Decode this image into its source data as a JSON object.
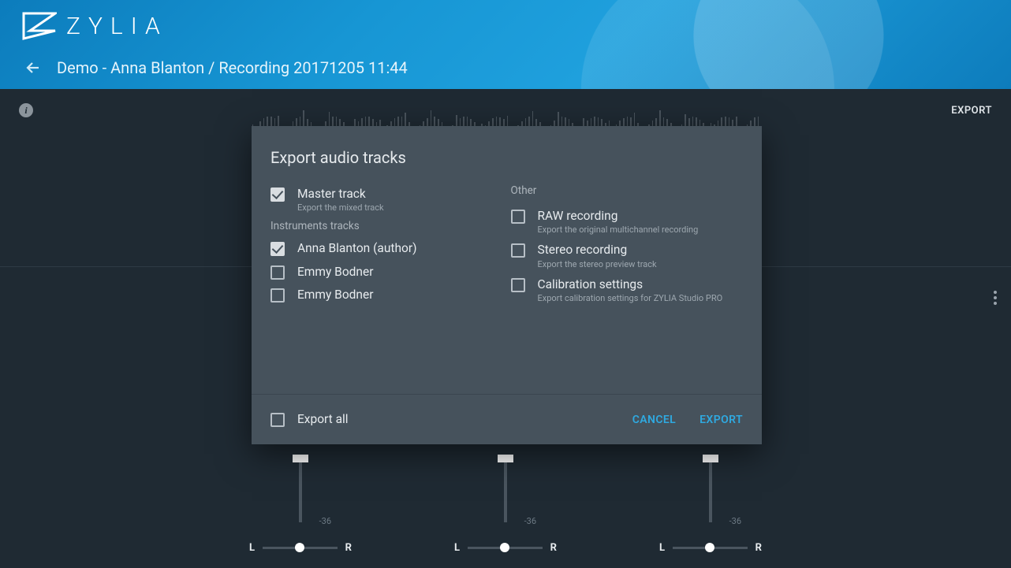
{
  "brand": {
    "name": "ZYLIA"
  },
  "breadcrumb": "Demo - Anna Blanton / Recording 20171205 11:44",
  "toolbar": {
    "export": "EXPORT"
  },
  "modal": {
    "title": "Export audio tracks",
    "master": {
      "label": "Master track",
      "sub": "Export the mixed track",
      "checked": true
    },
    "instruments_heading": "Instruments tracks",
    "instruments": [
      {
        "label": "Anna Blanton (author)",
        "checked": true
      },
      {
        "label": "Emmy Bodner",
        "checked": false
      },
      {
        "label": "Emmy Bodner",
        "checked": false
      }
    ],
    "other_heading": "Other",
    "other": [
      {
        "label": "RAW recording",
        "sub": "Export the original multichannel recording",
        "checked": false
      },
      {
        "label": "Stereo recording",
        "sub": "Export the stereo preview track",
        "checked": false
      },
      {
        "label": "Calibration settings",
        "sub": "Export calibration settings for ZYLIA Studio PRO",
        "checked": false
      }
    ],
    "export_all": {
      "label": "Export all",
      "checked": false
    },
    "cancel": "CANCEL",
    "export": "EXPORT"
  },
  "mixer": {
    "db_label": "-36",
    "pan_left": "L",
    "pan_right": "R",
    "channels": 3
  }
}
